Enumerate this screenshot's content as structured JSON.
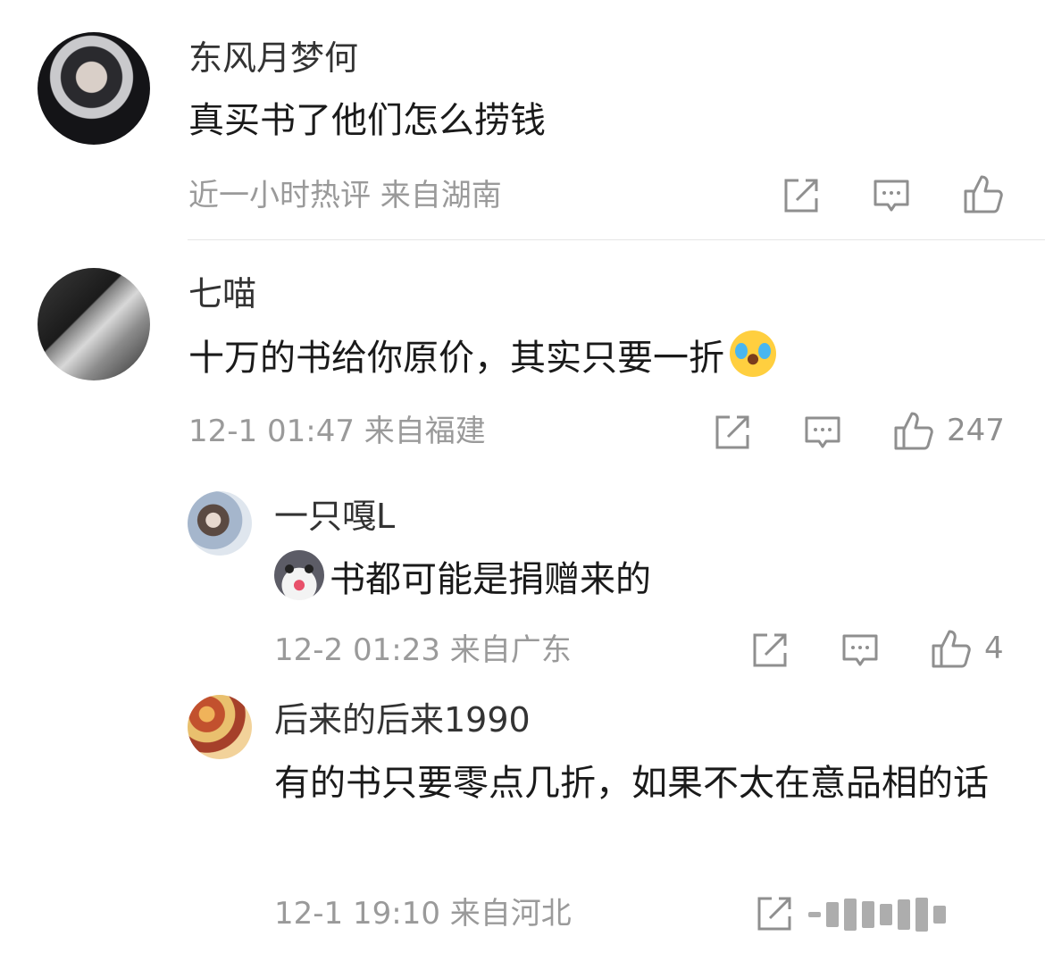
{
  "comments": [
    {
      "name": "东风月梦何",
      "text": "真买书了他们怎么捞钱",
      "meta": "近一小时热评  来自湖南",
      "like_count": ""
    },
    {
      "name": "七喵",
      "text": "十万的书给你原价，其实只要一折",
      "emoji": "laughing-crying-emoji",
      "meta": "12-1 01:47  来自福建",
      "like_count": "247"
    },
    {
      "name": "一只嘎L",
      "emoji": "husky-emoji",
      "text": "书都可能是捐赠来的",
      "meta": "12-2 01:23  来自广东",
      "like_count": "4"
    },
    {
      "name": "后来的后来1990",
      "text": "有的书只要零点几折，如果不太在意品相的话",
      "meta": "12-1 19:10  来自河北",
      "like_count": ""
    }
  ],
  "colors": {
    "meta": "#9a9a9a",
    "name": "#333333",
    "text": "#1a1a1a",
    "divider": "#e6e6e6"
  },
  "icons": [
    "share-icon",
    "reply-icon",
    "like-icon"
  ]
}
